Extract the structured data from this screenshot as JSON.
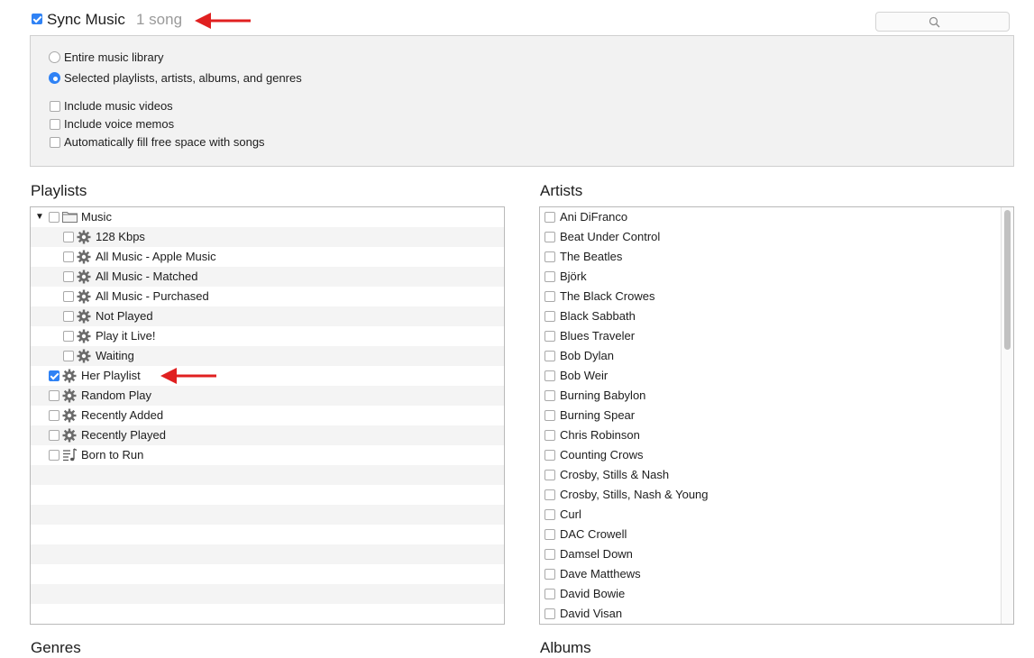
{
  "sync": {
    "label": "Sync Music",
    "count": "1 song",
    "checked": true
  },
  "search": {
    "icon": "search-icon"
  },
  "options": {
    "radios": [
      {
        "label": "Entire music library",
        "selected": false
      },
      {
        "label": "Selected playlists, artists, albums, and genres",
        "selected": true
      }
    ],
    "checkboxes": [
      {
        "label": "Include music videos",
        "checked": false
      },
      {
        "label": "Include voice memos",
        "checked": false
      },
      {
        "label": "Automatically fill free space with songs",
        "checked": false
      }
    ]
  },
  "playlists": {
    "title": "Playlists",
    "items": [
      {
        "label": "Music",
        "icon": "folder-icon",
        "checked": false
      },
      {
        "label": "128 Kbps",
        "icon": "gear-icon",
        "checked": false
      },
      {
        "label": "All Music - Apple Music",
        "icon": "gear-icon",
        "checked": false
      },
      {
        "label": "All Music - Matched",
        "icon": "gear-icon",
        "checked": false
      },
      {
        "label": "All Music - Purchased",
        "icon": "gear-icon",
        "checked": false
      },
      {
        "label": "Not Played",
        "icon": "gear-icon",
        "checked": false
      },
      {
        "label": "Play it Live!",
        "icon": "gear-icon",
        "checked": false
      },
      {
        "label": "Waiting",
        "icon": "gear-icon",
        "checked": false
      },
      {
        "label": "Her Playlist",
        "icon": "gear-icon",
        "checked": true
      },
      {
        "label": "Random Play",
        "icon": "gear-icon",
        "checked": false
      },
      {
        "label": "Recently Added",
        "icon": "gear-icon",
        "checked": false
      },
      {
        "label": "Recently Played",
        "icon": "gear-icon",
        "checked": false
      },
      {
        "label": "Born to Run",
        "icon": "playlist-icon",
        "checked": false
      }
    ]
  },
  "artists": {
    "title": "Artists",
    "items": [
      "Ani DiFranco",
      "Beat Under Control",
      "The Beatles",
      "Björk",
      "The Black Crowes",
      "Black Sabbath",
      "Blues Traveler",
      "Bob Dylan",
      "Bob Weir",
      "Burning Babylon",
      "Burning Spear",
      "Chris Robinson",
      "Counting Crows",
      "Crosby, Stills & Nash",
      "Crosby, Stills, Nash & Young",
      "Curl",
      "DAC Crowell",
      "Damsel Down",
      "Dave Matthews",
      "David Bowie",
      "David Visan"
    ]
  },
  "bottom": {
    "genres_title": "Genres",
    "albums_title": "Albums"
  },
  "colors": {
    "accent": "#2f82f5",
    "arrow": "#e02020"
  }
}
